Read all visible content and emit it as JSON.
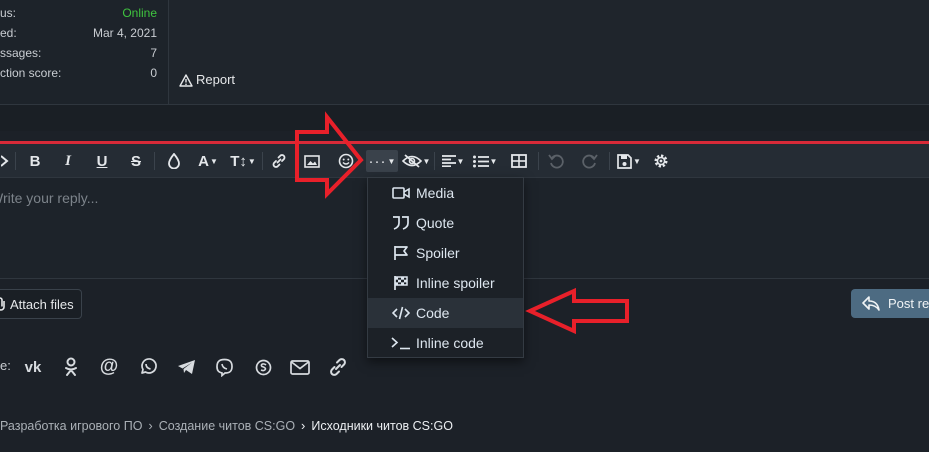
{
  "profile": {
    "stats": [
      {
        "label": "us:",
        "value": "Online",
        "online": true
      },
      {
        "label": "ed:",
        "value": "Mar 4, 2021",
        "online": false
      },
      {
        "label": "ssages:",
        "value": "7",
        "online": false
      },
      {
        "label": "ction score:",
        "value": "0",
        "online": false
      }
    ],
    "report_label": "Report"
  },
  "editor": {
    "placeholder": "Write your reply..."
  },
  "insert_menu": {
    "items": [
      {
        "label": "Media",
        "icon": "video-icon"
      },
      {
        "label": "Quote",
        "icon": "quote-icon"
      },
      {
        "label": "Spoiler",
        "icon": "flag-icon"
      },
      {
        "label": "Inline spoiler",
        "icon": "checkered-flag-icon"
      },
      {
        "label": "Code",
        "icon": "code-icon",
        "highlighted": true
      },
      {
        "label": "Inline code",
        "icon": "terminal-icon"
      }
    ]
  },
  "actions": {
    "attach_label": "Attach files",
    "post_label": "Post re"
  },
  "share": {
    "label": "e:",
    "icons": [
      "vk-icon",
      "odnoklassniki-icon",
      "at-icon",
      "whatsapp-icon",
      "telegram-icon",
      "viber-icon",
      "skype-icon",
      "email-icon",
      "link-icon"
    ]
  },
  "breadcrumb": {
    "items": [
      "Разработка игрового ПО",
      "Создание читов CS:GO",
      "Исходники читов CS:GO"
    ]
  },
  "colors": {
    "annotation": "#e8202a",
    "online": "#3fc43f",
    "post_button": "#4d6b82"
  }
}
